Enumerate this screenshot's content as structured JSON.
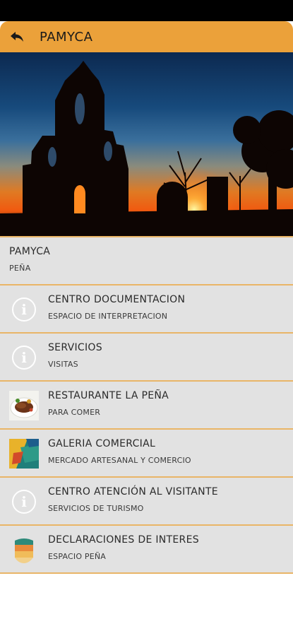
{
  "app_bar": {
    "title": "PAMYCA",
    "back_icon": "back-arrow-icon",
    "color": "#eba13a"
  },
  "hero": {
    "image": "church-belfry-sunset-photo"
  },
  "header": {
    "title": "PAMYCA",
    "subtitle": "PEÑA"
  },
  "accent_color": "#e9b567",
  "items": [
    {
      "title": "CENTRO DOCUMENTACION",
      "subtitle": "ESPACIO DE INTERPRETACION",
      "icon": "info-icon"
    },
    {
      "title": "SERVICIOS",
      "subtitle": "VISITAS",
      "icon": "info-icon"
    },
    {
      "title": "RESTAURANTE LA PEÑA",
      "subtitle": "PARA COMER",
      "icon": "food-plate-thumbnail"
    },
    {
      "title": "GALERIA COMERCIAL",
      "subtitle": "MERCADO ARTESANAL Y COMERCIO",
      "icon": "artisan-market-thumbnail"
    },
    {
      "title": "CENTRO ATENCIÓN AL VISITANTE",
      "subtitle": "SERVICIOS DE TURISMO",
      "icon": "info-icon"
    },
    {
      "title": "DECLARACIONES DE INTERES",
      "subtitle": "ESPACIO PEÑA",
      "icon": "pena-logo-thumbnail"
    }
  ]
}
